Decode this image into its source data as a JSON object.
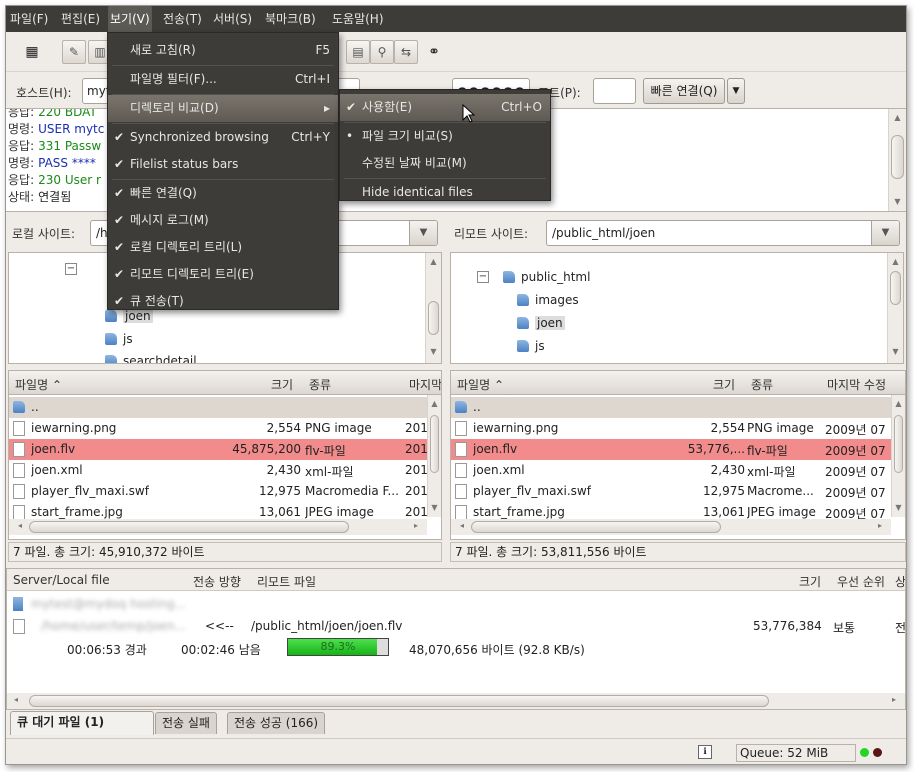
{
  "menubar": [
    "파일(F)",
    "편집(E)",
    "보기(V)",
    "전송(T)",
    "서버(S)",
    "북마크(B)",
    "도움말(H)"
  ],
  "quickconnect": {
    "host_label": "호스트(H):",
    "host_value": "myt",
    "password_value": "●●●●●●",
    "port_label": "포트(P):",
    "port_value": "",
    "connect_label": "빠른 연결(Q)",
    "dropdown_icon": "▼"
  },
  "log": [
    {
      "label": "응답:",
      "text": "220 BDAT",
      "color": "#1a8a1a"
    },
    {
      "label": "명령:",
      "text": "USER mytc",
      "color": "#1a2fb0"
    },
    {
      "label": "응답:",
      "text": "331 Passw",
      "color": "#1a8a1a"
    },
    {
      "label": "명령:",
      "text": "PASS ****",
      "color": "#1a2fb0"
    },
    {
      "label": "응답:",
      "text": "230 User r",
      "color": "#1a8a1a"
    },
    {
      "label": "상태:",
      "text": "연결됨",
      "color": "#222222"
    }
  ],
  "local": {
    "label": "로컬 사이트:",
    "path": "/h",
    "tree": [
      "joen",
      "js",
      "searchdetail"
    ],
    "columns": [
      "파일명",
      "크기",
      "종류",
      "마지막"
    ],
    "files": [
      {
        "name": "..",
        "size": "",
        "type": "",
        "date": ""
      },
      {
        "name": "iewarning.png",
        "size": "2,554",
        "type": "PNG image",
        "date": "201"
      },
      {
        "name": "joen.flv",
        "size": "45,875,200",
        "type": "flv-파일",
        "date": "201"
      },
      {
        "name": "joen.xml",
        "size": "2,430",
        "type": "xml-파일",
        "date": "201"
      },
      {
        "name": "player_flv_maxi.swf",
        "size": "12,975",
        "type": "Macromedia F...",
        "date": "201"
      },
      {
        "name": "start_frame.jpg",
        "size": "13,061",
        "type": "JPEG image",
        "date": "201"
      }
    ],
    "status": "7 파일. 총 크기: 45,910,372 바이트"
  },
  "remote": {
    "label": "리모트 사이트:",
    "path": "/public_html/joen",
    "tree": [
      "public_html",
      "images",
      "joen",
      "js"
    ],
    "columns": [
      "파일명",
      "크기",
      "종류",
      "마지막 수정"
    ],
    "files": [
      {
        "name": "..",
        "size": "",
        "type": "",
        "date": ""
      },
      {
        "name": "iewarning.png",
        "size": "2,554",
        "type": "PNG image",
        "date": "2009년 07"
      },
      {
        "name": "joen.flv",
        "size": "53,776,...",
        "type": "flv-파일",
        "date": "2009년 07"
      },
      {
        "name": "joen.xml",
        "size": "2,430",
        "type": "xml-파일",
        "date": "2009년 07"
      },
      {
        "name": "player_flv_maxi.swf",
        "size": "12,975",
        "type": "Macrome...",
        "date": "2009년 07"
      },
      {
        "name": "start_frame.jpg",
        "size": "13,061",
        "type": "JPEG image",
        "date": "2009년 07"
      }
    ],
    "status": "7 파일. 총 크기: 53,811,556 바이트"
  },
  "queue": {
    "columns": [
      "Server/Local file",
      "전송 방향",
      "리모트 파일",
      "크기",
      "우선 순위",
      "상"
    ],
    "server": "mytest@mydoq hosting...",
    "local_path": "/home/user/temp/joen...",
    "direction": "<<--",
    "remote_file": "/public_html/joen/joen.flv",
    "size": "53,776,384",
    "priority": "보통",
    "state": "전",
    "elapsed": "00:06:53 경과",
    "remaining": "00:02:46 남음",
    "progress_text": "89.3%",
    "progress_fraction": 0.893,
    "transferred": "48,070,656 바이트 (92.8 KB/s)"
  },
  "tabs": [
    "큐 대기 파일 (1)",
    "전송 실패",
    "전송 성공 (166)"
  ],
  "statusbar": {
    "queue": "Queue: 52 MiB"
  },
  "view_menu": {
    "items": [
      {
        "label": "새로 고침(R)",
        "accel": "F5",
        "check": ""
      },
      {
        "label": "파일명 필터(F)...",
        "accel": "Ctrl+I",
        "check": ""
      },
      {
        "label": "디렉토리 비교(D)",
        "accel": "▸",
        "check": ""
      },
      {
        "label": "Synchronized browsing",
        "accel": "Ctrl+Y",
        "check": "✔"
      },
      {
        "label": "Filelist status bars",
        "accel": "",
        "check": "✔"
      },
      {
        "label": "빠른 연결(Q)",
        "accel": "",
        "check": "✔"
      },
      {
        "label": "메시지 로그(M)",
        "accel": "",
        "check": "✔"
      },
      {
        "label": "로컬 디렉토리 트리(L)",
        "accel": "",
        "check": "✔"
      },
      {
        "label": "리모트 디렉토리 트리(E)",
        "accel": "",
        "check": "✔"
      },
      {
        "label": "큐 전송(T)",
        "accel": "",
        "check": "✔"
      }
    ]
  },
  "compare_submenu": {
    "items": [
      {
        "label": "사용함(E)",
        "accel": "Ctrl+O",
        "check": "✔"
      },
      {
        "label": "파일 크기 비교(S)",
        "accel": "",
        "check": "•"
      },
      {
        "label": "수정된 날짜 비교(M)",
        "accel": "",
        "check": ""
      },
      {
        "label": "Hide identical files",
        "accel": "",
        "check": ""
      }
    ]
  },
  "colors": {
    "highlight_row": "#f28b8b",
    "menubar": "#3d3c38",
    "progress": "#22c422"
  }
}
